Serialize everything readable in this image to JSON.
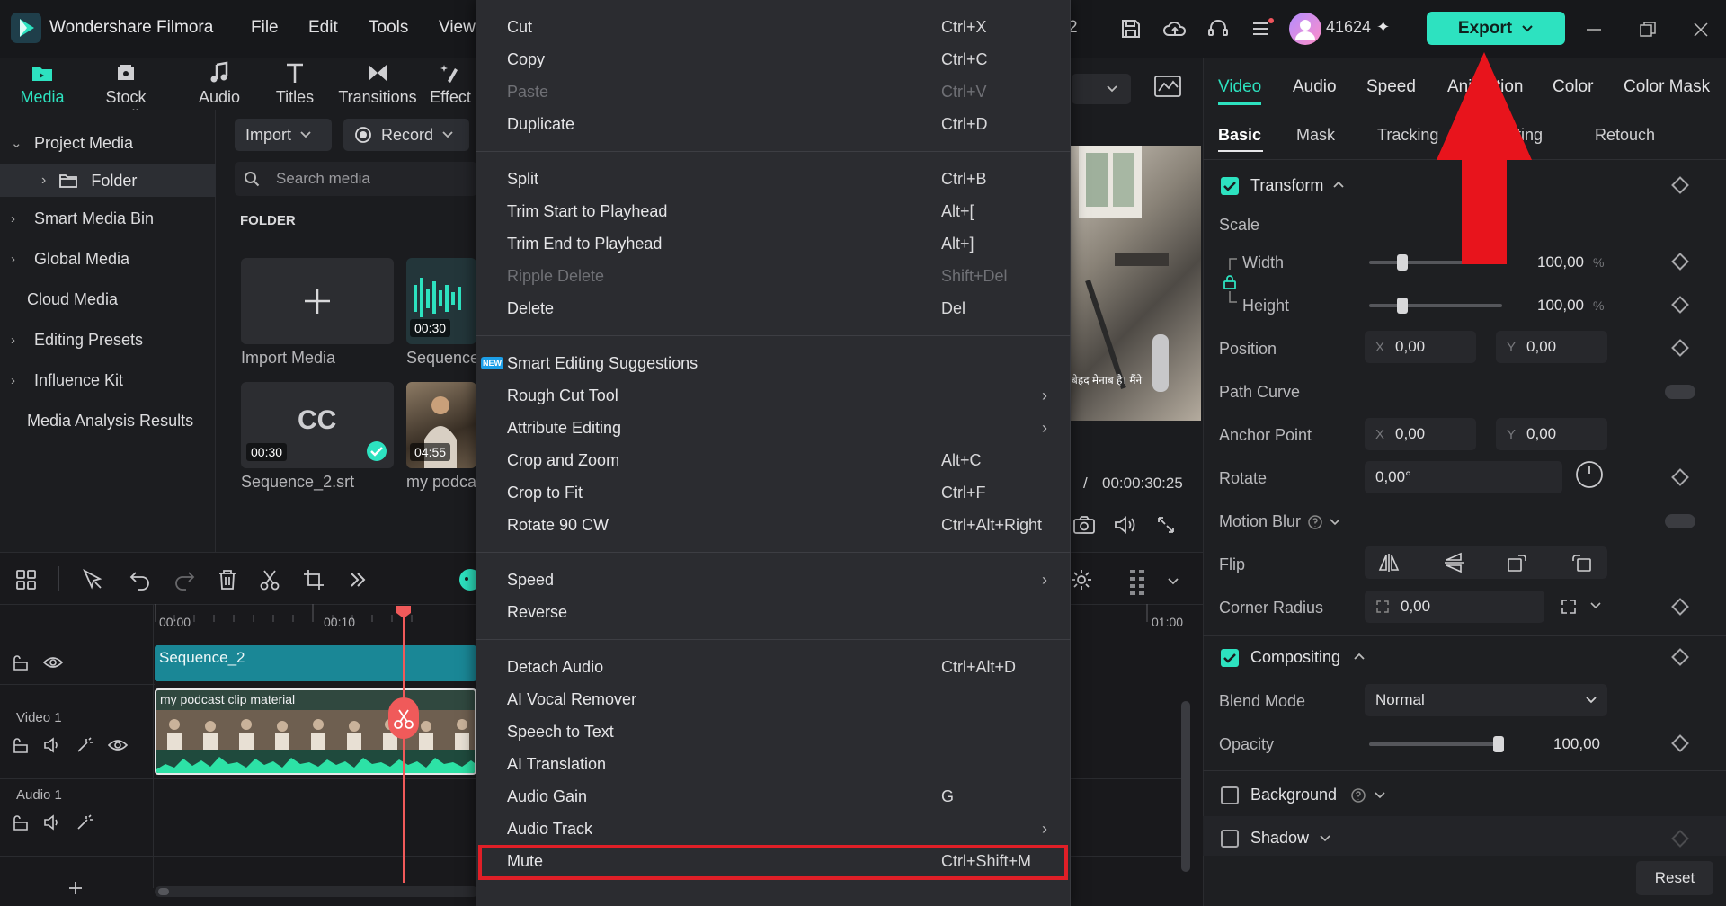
{
  "app": {
    "name": "Wondershare Filmora"
  },
  "menubar": [
    "File",
    "Edit",
    "Tools",
    "View"
  ],
  "header": {
    "badge_count": "2",
    "credits": "41624",
    "export_label": "Export"
  },
  "toolbar": [
    {
      "label": "Media",
      "icon": "folder-icon"
    },
    {
      "label": "Stock Media",
      "icon": "stock-icon"
    },
    {
      "label": "Audio",
      "icon": "music-note-icon"
    },
    {
      "label": "Titles",
      "icon": "title-t-icon"
    },
    {
      "label": "Transitions",
      "icon": "transition-icon"
    },
    {
      "label": "Effect",
      "icon": "effects-icon"
    }
  ],
  "left_panel": {
    "project_media": "Project Media",
    "folder": "Folder",
    "items": [
      "Smart Media Bin",
      "Global Media",
      "Cloud Media",
      "Editing Presets",
      "Influence Kit",
      "Media Analysis Results"
    ]
  },
  "media": {
    "import_label": "Import",
    "record_label": "Record",
    "search_placeholder": "Search media",
    "folder_heading": "FOLDER",
    "tiles": [
      {
        "label": "Import Media"
      },
      {
        "label": "Sequence",
        "duration": "00:30"
      },
      {
        "label": "Sequence_2.srt",
        "duration": "00:30"
      },
      {
        "label": "my podca",
        "duration": "04:55"
      }
    ],
    "cc_label": "CC"
  },
  "preview": {
    "total_time": "00:00:30:25",
    "slash": "/",
    "subtitle": "बेहद मेनाब है। मैंने"
  },
  "right_panel": {
    "tabs": [
      "Video",
      "Audio",
      "Speed",
      "Animation",
      "Color",
      "Color Mask"
    ],
    "subtabs": [
      "Basic",
      "Mask",
      "Tracking",
      "Adjusting",
      "Retouch"
    ],
    "transform": "Transform",
    "scale": "Scale",
    "width_label": "Width",
    "width_value": "100,00",
    "height_label": "Height",
    "height_value": "100,00",
    "percent": "%",
    "position": "Position",
    "pos_x": "0,00",
    "pos_y": "0,00",
    "path_curve": "Path Curve",
    "anchor_point": "Anchor Point",
    "anchor_x": "0,00",
    "anchor_y": "0,00",
    "rotate": "Rotate",
    "rotate_value": "0,00°",
    "motion_blur": "Motion Blur",
    "flip": "Flip",
    "corner_radius": "Corner Radius",
    "corner_value": "0,00",
    "compositing": "Compositing",
    "blend_mode": "Blend Mode",
    "blend_value": "Normal",
    "opacity": "Opacity",
    "opacity_value": "100,00",
    "background": "Background",
    "shadow": "Shadow",
    "reset": "Reset",
    "x": "X",
    "y": "Y",
    "width_level": 0.25,
    "height_level": 0.25,
    "opacity_level": 1.0
  },
  "timeline": {
    "ticks": [
      "00:00",
      "00:10",
      "01:00"
    ],
    "sequence_clip": "Sequence_2",
    "video_clip": "my podcast clip material",
    "video_track": "Video 1",
    "audio_track": "Audio 1"
  },
  "context_menu": {
    "groups": [
      [
        {
          "label": "Cut",
          "shortcut": "Ctrl+X"
        },
        {
          "label": "Copy",
          "shortcut": "Ctrl+C"
        },
        {
          "label": "Paste",
          "shortcut": "Ctrl+V",
          "disabled": true
        },
        {
          "label": "Duplicate",
          "shortcut": "Ctrl+D"
        }
      ],
      [
        {
          "label": "Split",
          "shortcut": "Ctrl+B"
        },
        {
          "label": "Trim Start to Playhead",
          "shortcut": "Alt+["
        },
        {
          "label": "Trim End to Playhead",
          "shortcut": "Alt+]"
        },
        {
          "label": "Ripple Delete",
          "shortcut": "Shift+Del",
          "disabled": true
        },
        {
          "label": "Delete",
          "shortcut": "Del"
        }
      ],
      [
        {
          "label": "Smart Editing Suggestions",
          "shortcut": "",
          "badge": "NEW"
        },
        {
          "label": "Rough Cut Tool",
          "shortcut": "",
          "submenu": true
        },
        {
          "label": "Attribute Editing",
          "shortcut": "",
          "submenu": true
        },
        {
          "label": "Crop and Zoom",
          "shortcut": "Alt+C"
        },
        {
          "label": "Crop to Fit",
          "shortcut": "Ctrl+F"
        },
        {
          "label": "Rotate 90 CW",
          "shortcut": "Ctrl+Alt+Right"
        }
      ],
      [
        {
          "label": "Speed",
          "shortcut": "",
          "submenu": true
        },
        {
          "label": "Reverse",
          "shortcut": ""
        }
      ],
      [
        {
          "label": "Detach Audio",
          "shortcut": "Ctrl+Alt+D"
        },
        {
          "label": "AI Vocal Remover",
          "shortcut": ""
        },
        {
          "label": "Speech to Text",
          "shortcut": ""
        },
        {
          "label": "AI Translation",
          "shortcut": ""
        },
        {
          "label": "Audio Gain",
          "shortcut": "G"
        },
        {
          "label": "Audio Track",
          "shortcut": "",
          "submenu": true
        },
        {
          "label": "Mute",
          "shortcut": "Ctrl+Shift+M",
          "highlighted": true
        }
      ]
    ]
  },
  "colors": {
    "accent": "#2de2c0",
    "highlight": "#e01f27",
    "arrow": "#e8141c",
    "playhead": "#f05a5a"
  }
}
